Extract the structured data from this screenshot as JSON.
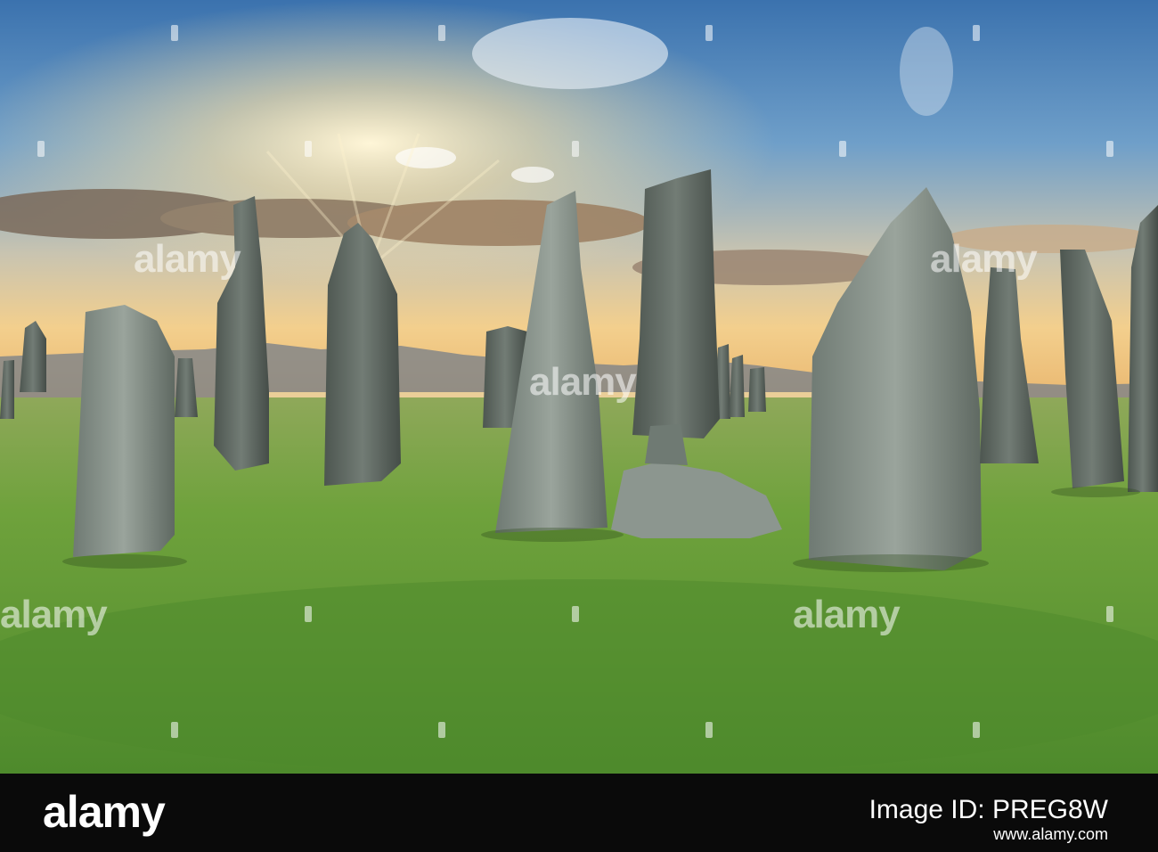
{
  "watermark": {
    "text": "alamy",
    "dot": "a"
  },
  "footer": {
    "brand": "alamy",
    "image_id": "Image ID: PREG8W",
    "url": "www.alamy.com"
  },
  "colors": {
    "sky_top": "#3f79b6",
    "sky_horizon": "#f2c98a",
    "grass": "#6aa53a",
    "stone": "#8f9a92",
    "bar": "#0a0a0a"
  },
  "icons": {
    "logo": "alamy-wordmark"
  }
}
